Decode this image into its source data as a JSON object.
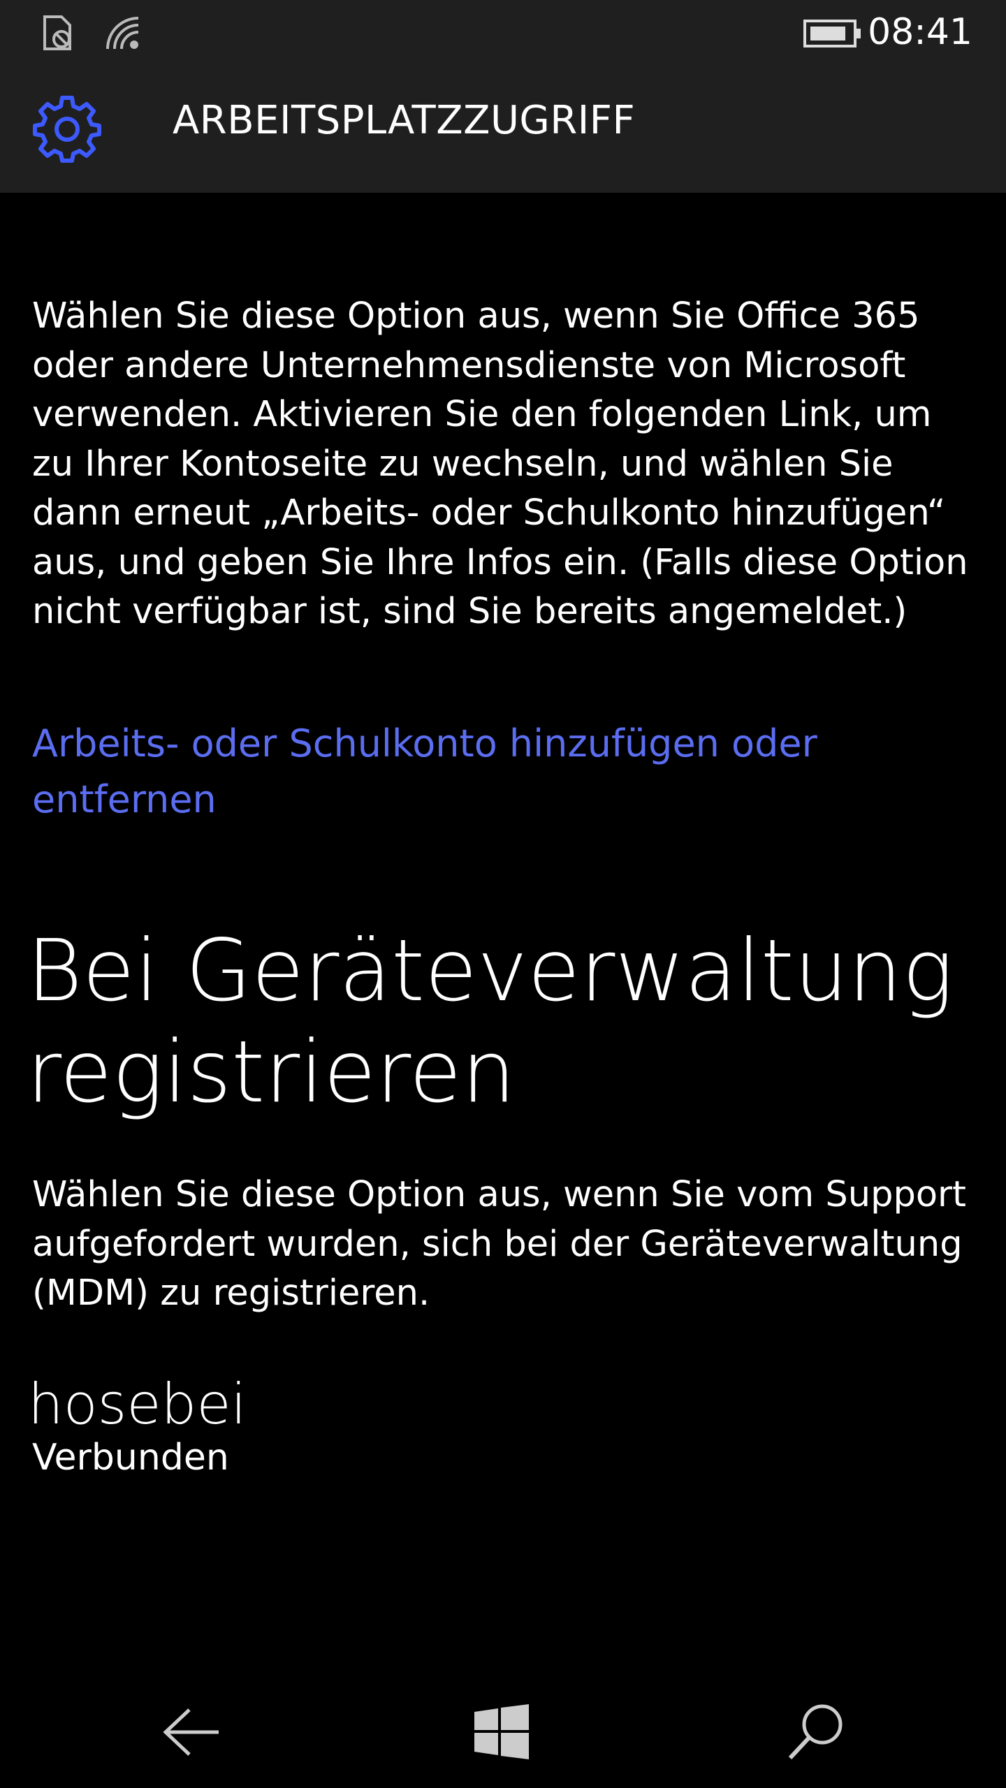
{
  "status_bar": {
    "time": "08:41",
    "icons": [
      "sim-absent-icon",
      "wifi-icon",
      "battery-icon"
    ]
  },
  "header": {
    "title": "ARBEITSPLATZZUGRIFF",
    "icon": "gear-icon",
    "accent_color": "#3d5afe"
  },
  "content": {
    "description_1": "Wählen Sie diese Option aus, wenn Sie Office 365 oder andere Unternehmensdienste von Microsoft verwenden. Aktivieren Sie den folgenden Link, um zu Ihrer Kontoseite zu wechseln, und wählen Sie dann erneut „Arbeits- oder Schulkonto hinzufügen“ aus, und geben Sie Ihre Infos ein. (Falls diese Option nicht verfügbar ist, sind Sie bereits angemeldet.)",
    "link_label": "Arbeits- oder Schulkonto hinzufügen oder entfernen",
    "link_color": "#5b6df0",
    "section_title": "Bei Geräteverwaltung registrieren",
    "description_2": "Wählen Sie diese Option aus, wenn Sie vom Support aufgefordert wurden, sich bei der Geräteverwaltung (MDM) zu registrieren.",
    "account": {
      "name": "hosebei",
      "status": "Verbunden"
    }
  },
  "nav_bar": {
    "buttons": [
      "back-arrow-icon",
      "windows-logo-icon",
      "search-icon"
    ]
  }
}
